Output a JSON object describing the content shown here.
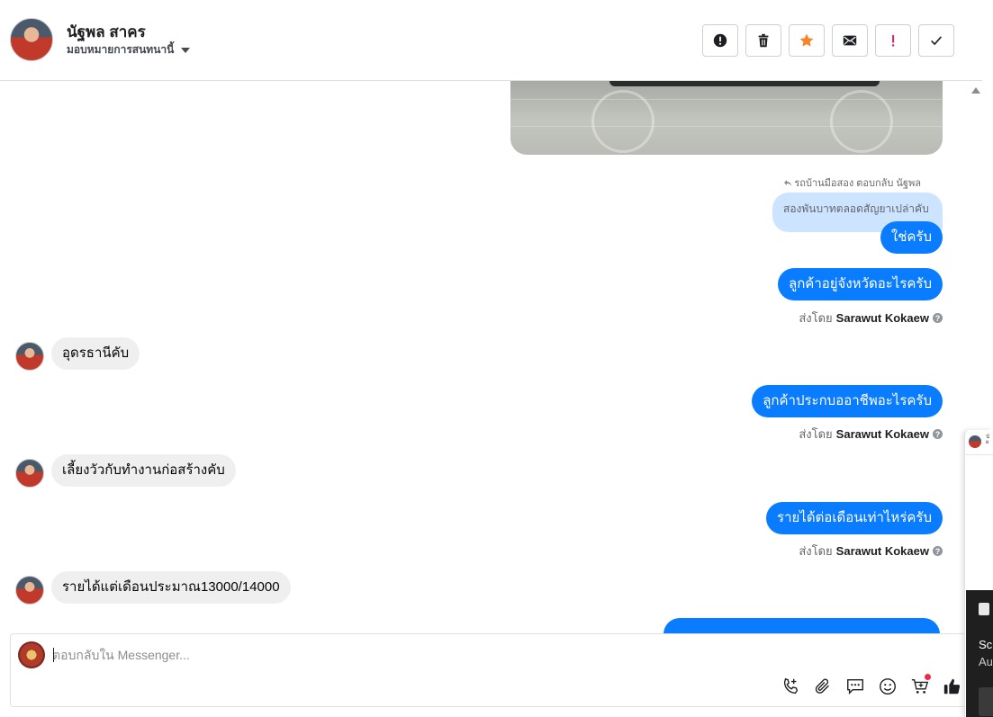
{
  "header": {
    "contact_name": "นัฐพล สาคร",
    "assign_label": "มอบหมายการสนทนานี้",
    "toolbar": [
      {
        "icon": "alert-circle-icon",
        "name": "mark-spam-button"
      },
      {
        "icon": "trash-icon",
        "name": "delete-button"
      },
      {
        "icon": "star-icon",
        "name": "star-button"
      },
      {
        "icon": "envelope-icon",
        "name": "mark-unread-button"
      },
      {
        "icon": "exclamation-icon",
        "name": "flag-button"
      },
      {
        "icon": "check-icon",
        "name": "mark-done-button"
      }
    ]
  },
  "conversation": {
    "reply_header": "รถบ้านมือสอง ตอบกลับ นัฐพล",
    "reply_quote": "สองพันบาทตลอดสัญยาเปล่าคับ",
    "messages": [
      {
        "dir": "out",
        "text": "ใช่ครับ"
      },
      {
        "dir": "out",
        "text": "ลูกค้าอยู่จังหวัดอะไรครับ",
        "sent_by_prefix": "ส่งโดย",
        "sent_by": "Sarawut Kokaew"
      },
      {
        "dir": "in",
        "text": "อุดรธานีคับ"
      },
      {
        "dir": "out",
        "text": "ลูกค้าประกบออาชีพอะไรครับ",
        "sent_by_prefix": "ส่งโดย",
        "sent_by": "Sarawut Kokaew"
      },
      {
        "dir": "in",
        "text": "เลี้ยงวัวกับทำงานก่อสร้างคับ"
      },
      {
        "dir": "out",
        "text": "รายได้ต่อเดือนเท่าไหร่ครับ",
        "sent_by_prefix": "ส่งโดย",
        "sent_by": "Sarawut Kokaew"
      },
      {
        "dir": "in",
        "text": "รายได้แต่เดือนประมาณ13000/14000"
      }
    ]
  },
  "composer": {
    "placeholder": "ตอบกลับใน Messenger...",
    "tools": [
      "add-call-icon",
      "paperclip-icon",
      "saved-replies-icon",
      "emoji-icon",
      "cart-icon",
      "thumbs-up-icon"
    ]
  },
  "notification": {
    "title": "Sc",
    "subtitle": "Au"
  },
  "side_chat": {
    "line1": "นั",
    "line2": "ผ"
  },
  "colors": {
    "outgoing": "#0a7cff",
    "incoming": "#efefef",
    "star": "#f5852b",
    "flag": "#e0245e"
  }
}
